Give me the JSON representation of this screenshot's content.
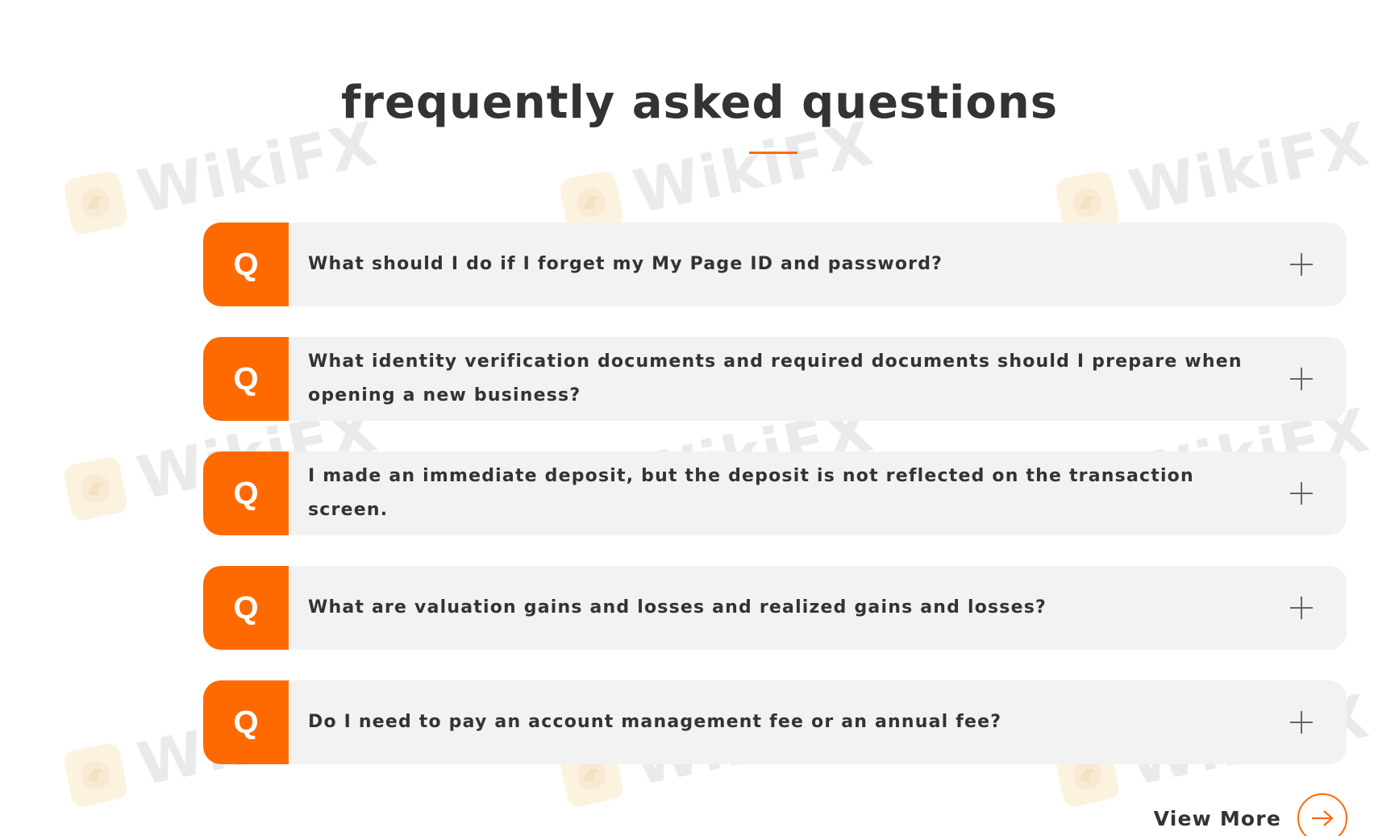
{
  "section": {
    "title": "frequently asked questions"
  },
  "faq": {
    "badge_label": "Q",
    "toggle_icon": "plus-icon",
    "items": [
      {
        "question": "What should I do if I forget my My Page ID and password?"
      },
      {
        "question": "What identity verification documents and required documents should I prepare when opening a new business?"
      },
      {
        "question": "I made an immediate deposit, but the deposit is not reflected on the transaction screen."
      },
      {
        "question": "What are valuation gains and losses and realized gains and losses?"
      },
      {
        "question": "Do I need to pay an account management fee or an annual fee?"
      }
    ]
  },
  "view_more": {
    "label": "View More",
    "icon": "arrow-right-icon"
  },
  "watermark": {
    "text": "WikiFX"
  },
  "colors": {
    "accent": "#ff6a00",
    "card_bg": "#f2f2f2",
    "text": "#333333"
  }
}
